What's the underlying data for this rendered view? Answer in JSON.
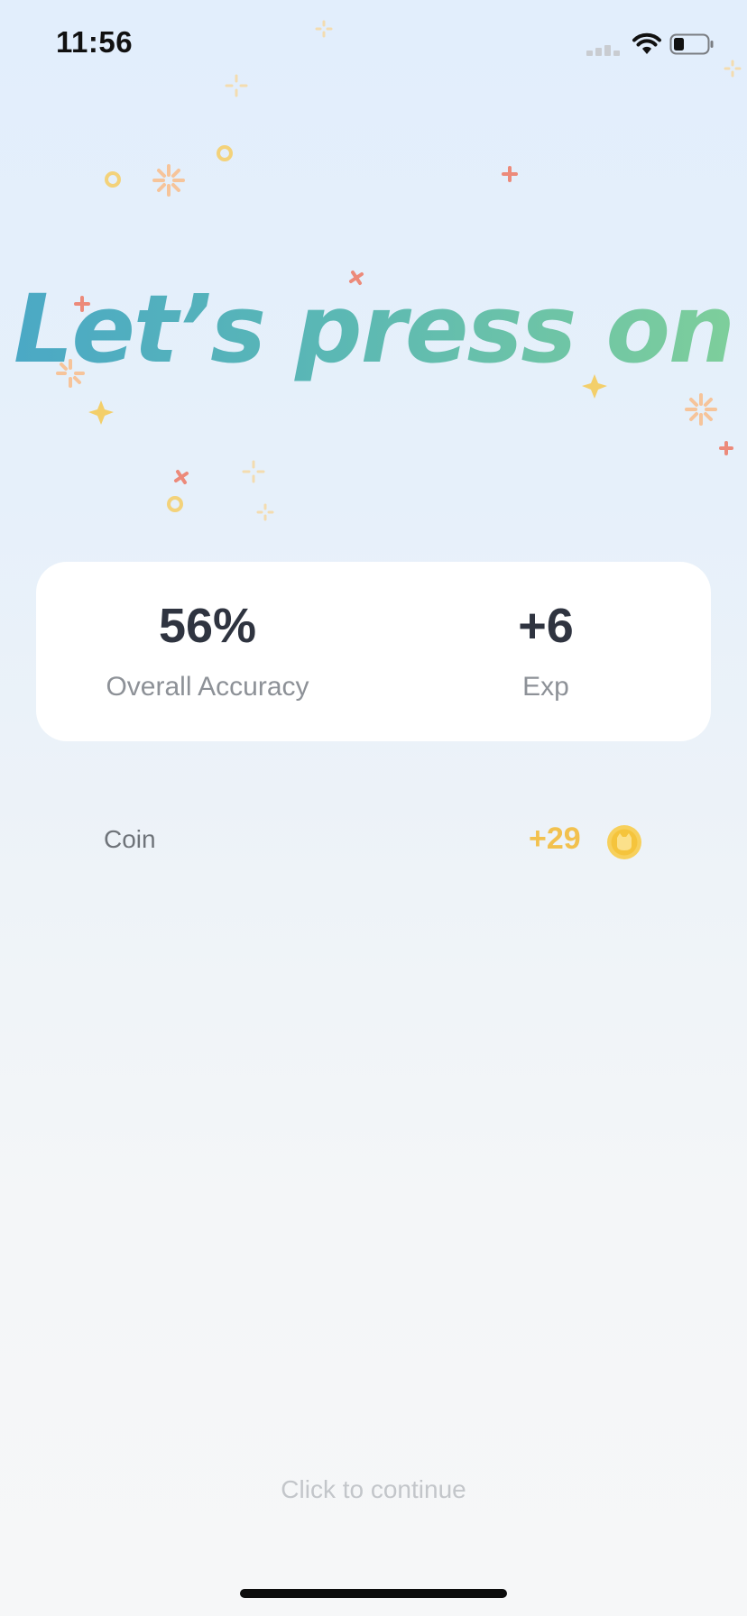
{
  "status_bar": {
    "time": "11:56"
  },
  "headline": "Let’s press on",
  "stats": {
    "accuracy_value": "56%",
    "accuracy_label": "Overall Accuracy",
    "exp_value": "+6",
    "exp_label": "Exp"
  },
  "coin": {
    "label": "Coin",
    "value": "+29",
    "icon": "coin-icon"
  },
  "continue_text": "Click to continue",
  "colors": {
    "headline_start": "#4aa8c6",
    "headline_end": "#7fcf9a",
    "coin_gold": "#f2c14e",
    "stat_text": "#2f3440",
    "label_gray": "#8d9197"
  }
}
